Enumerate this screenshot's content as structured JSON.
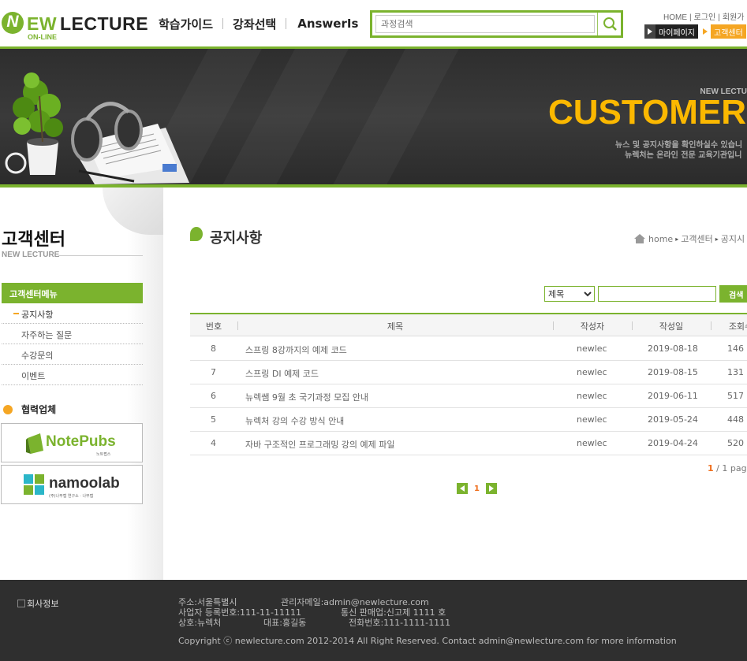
{
  "header": {
    "logo_ew": "EW",
    "logo_lecture": "LECTURE",
    "logo_sub": "ON-LINE",
    "logo_initial": "N",
    "nav": [
      "학습가이드",
      "강좌선택",
      "AnswerIs"
    ],
    "search_placeholder": "과정검색",
    "util": [
      "HOME",
      "로그인",
      "회원가"
    ],
    "quick_links": [
      "마이페이지",
      "고객센터"
    ]
  },
  "banner": {
    "sub": "NEW LECTU",
    "title": "CUSTOMER",
    "desc1": "뉴스 및 공지사항을 확인하실수 있습니",
    "desc2": "뉴렉처는 온라인 전문 교육기관입니"
  },
  "sidebar": {
    "title": "고객센터",
    "subtitle": "NEW LECTURE",
    "menu_head": "고객센터메뉴",
    "menu": [
      "공지사항",
      "자주하는 질문",
      "수강문의",
      "이벤트"
    ],
    "partner_title": "협력업체",
    "partners": [
      {
        "name": "NotePubs",
        "sub": "노트펍스"
      },
      {
        "name": "namoolab",
        "sub": "(주)나무랩 연구소 · 나무랩"
      }
    ]
  },
  "main": {
    "title": "공지사항",
    "breadcrumb": [
      "home",
      "고객센터",
      "공지시"
    ],
    "filter_option": "제목",
    "filter_button": "검색",
    "columns": [
      "번호",
      "제목",
      "작성자",
      "작성일",
      "조회수"
    ],
    "rows": [
      {
        "no": "8",
        "title": "스프링 8강까지의 예제 코드",
        "writer": "newlec",
        "date": "2019-08-18",
        "hit": "146"
      },
      {
        "no": "7",
        "title": "스프링 DI 예제 코드",
        "writer": "newlec",
        "date": "2019-08-15",
        "hit": "131"
      },
      {
        "no": "6",
        "title": "뉴렉쌤 9월 초 국기과정 모집 안내",
        "writer": "newlec",
        "date": "2019-06-11",
        "hit": "517"
      },
      {
        "no": "5",
        "title": "뉴렉처 강의 수강 방식 안내",
        "writer": "newlec",
        "date": "2019-05-24",
        "hit": "448"
      },
      {
        "no": "4",
        "title": "자바 구조적인 프로그래밍 강의 예제 파일",
        "writer": "newlec",
        "date": "2019-04-24",
        "hit": "520"
      }
    ],
    "page_current": "1",
    "page_total": "/ 1 pag",
    "pager_num": "1"
  },
  "footer": {
    "logo_alt": "회사정보",
    "address": "주소:서울특별시",
    "email": "관리자메일:admin@newlecture.com",
    "biz_no": "사업자 등록번호:111-11-11111",
    "sale_no": "통신 판매업:신고제 1111 호",
    "company": "상호:뉴렉처",
    "ceo": "대표:홍길동",
    "tel": "전화번호:111-1111-1111",
    "copyright": "Copyright ⓒ newlecture.com 2012-2014 All Right Reserved. Contact admin@newlecture.com for more information"
  },
  "colors": {
    "accent": "#7bb32e",
    "orange": "#f5a623",
    "banner_title": "#fbb800",
    "footer_bg": "#2f2f2f"
  }
}
